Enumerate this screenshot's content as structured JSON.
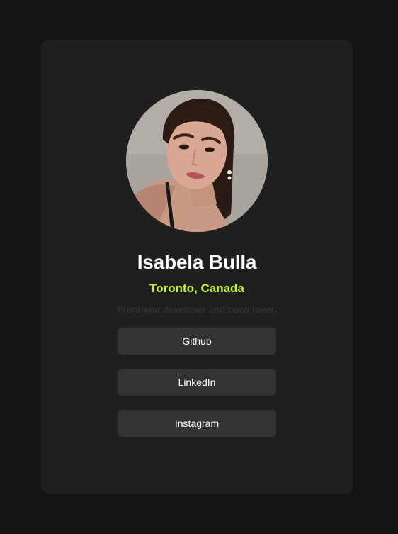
{
  "profile": {
    "name": "Isabela Bulla",
    "location": "Toronto, Canada",
    "bio": "Front-end developer and book lover.",
    "avatar_icon": "profile-photo"
  },
  "links": [
    {
      "label": "Github"
    },
    {
      "label": "LinkedIn"
    },
    {
      "label": "Instagram"
    }
  ],
  "colors": {
    "page_background": "#141414",
    "card_background": "#1f1f1f",
    "accent": "#c4f82a",
    "button_background": "#333333",
    "text": "#ffffff",
    "muted_text": "#2f2f2f"
  }
}
